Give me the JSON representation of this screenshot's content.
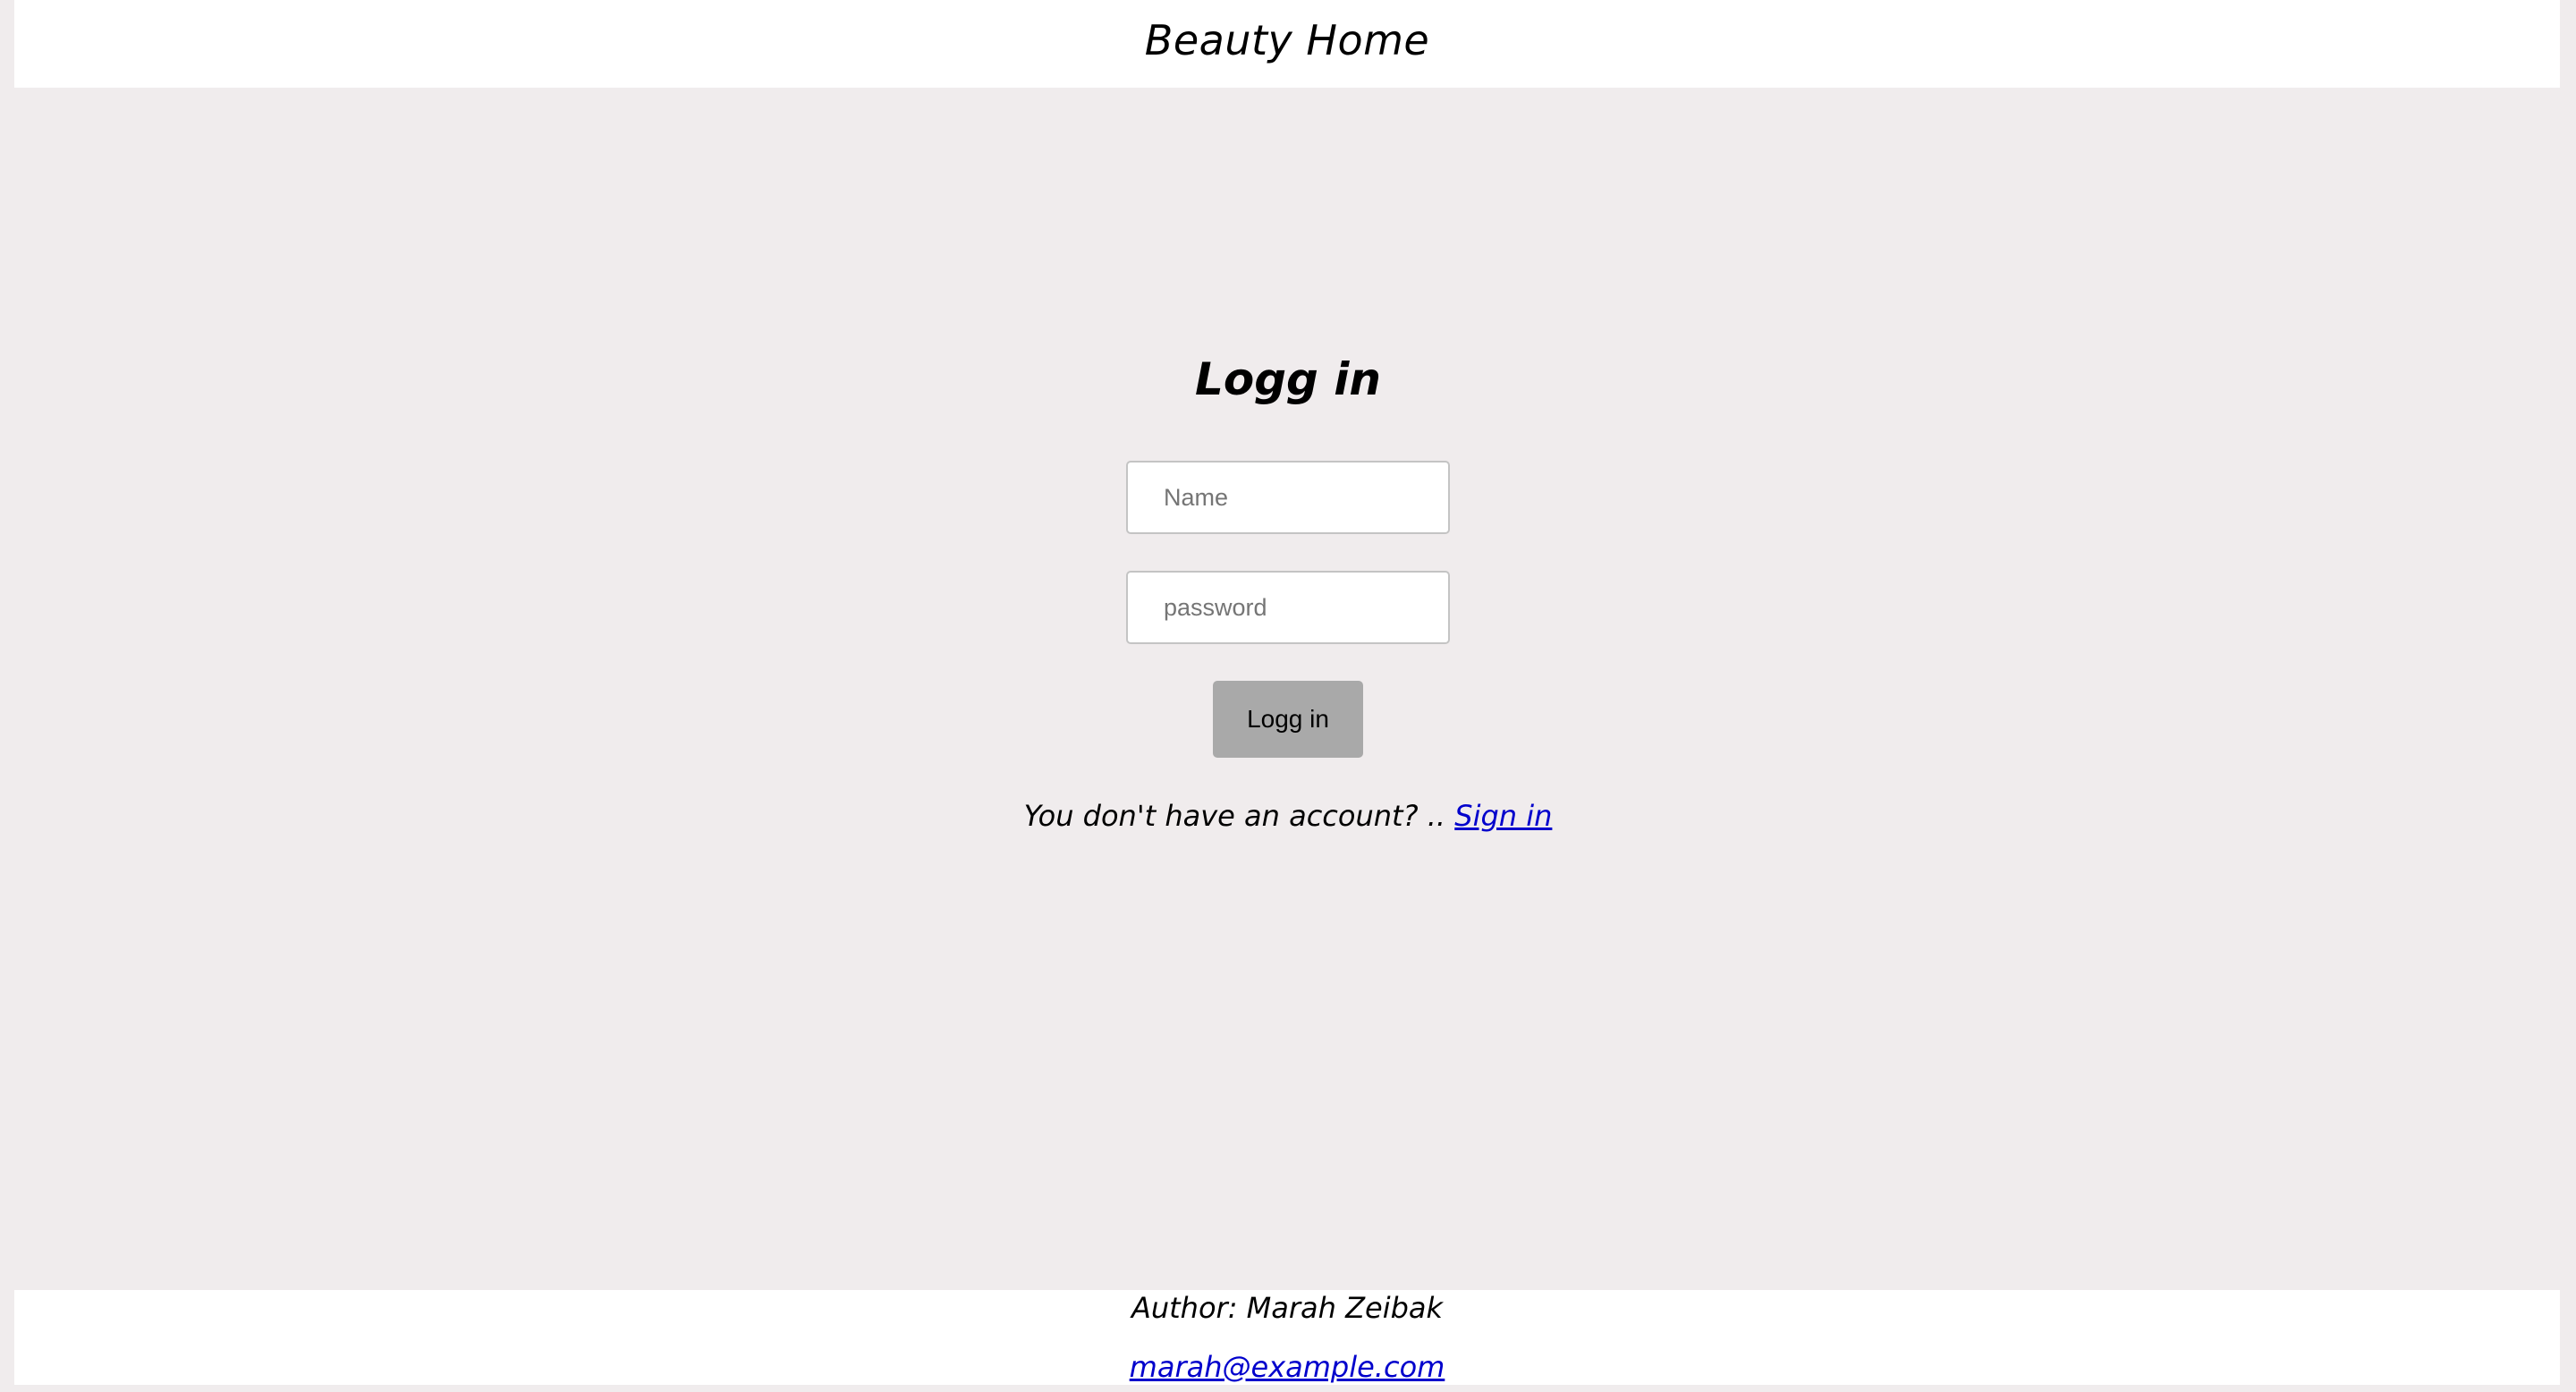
{
  "header": {
    "title": "Beauty Home"
  },
  "login": {
    "title": "Logg in",
    "name_placeholder": "Name",
    "password_placeholder": "password",
    "button_label": "Logg in",
    "account_prompt": "You don't have an account? ..",
    "signin_link": "Sign in"
  },
  "footer": {
    "author": "Author: Marah Zeibak",
    "email": "marah@example.com"
  },
  "colors": {
    "page_background": "#f0eced",
    "panel_background": "#ffffff",
    "button_background": "#a9a9a9",
    "link": "#0000cc"
  }
}
